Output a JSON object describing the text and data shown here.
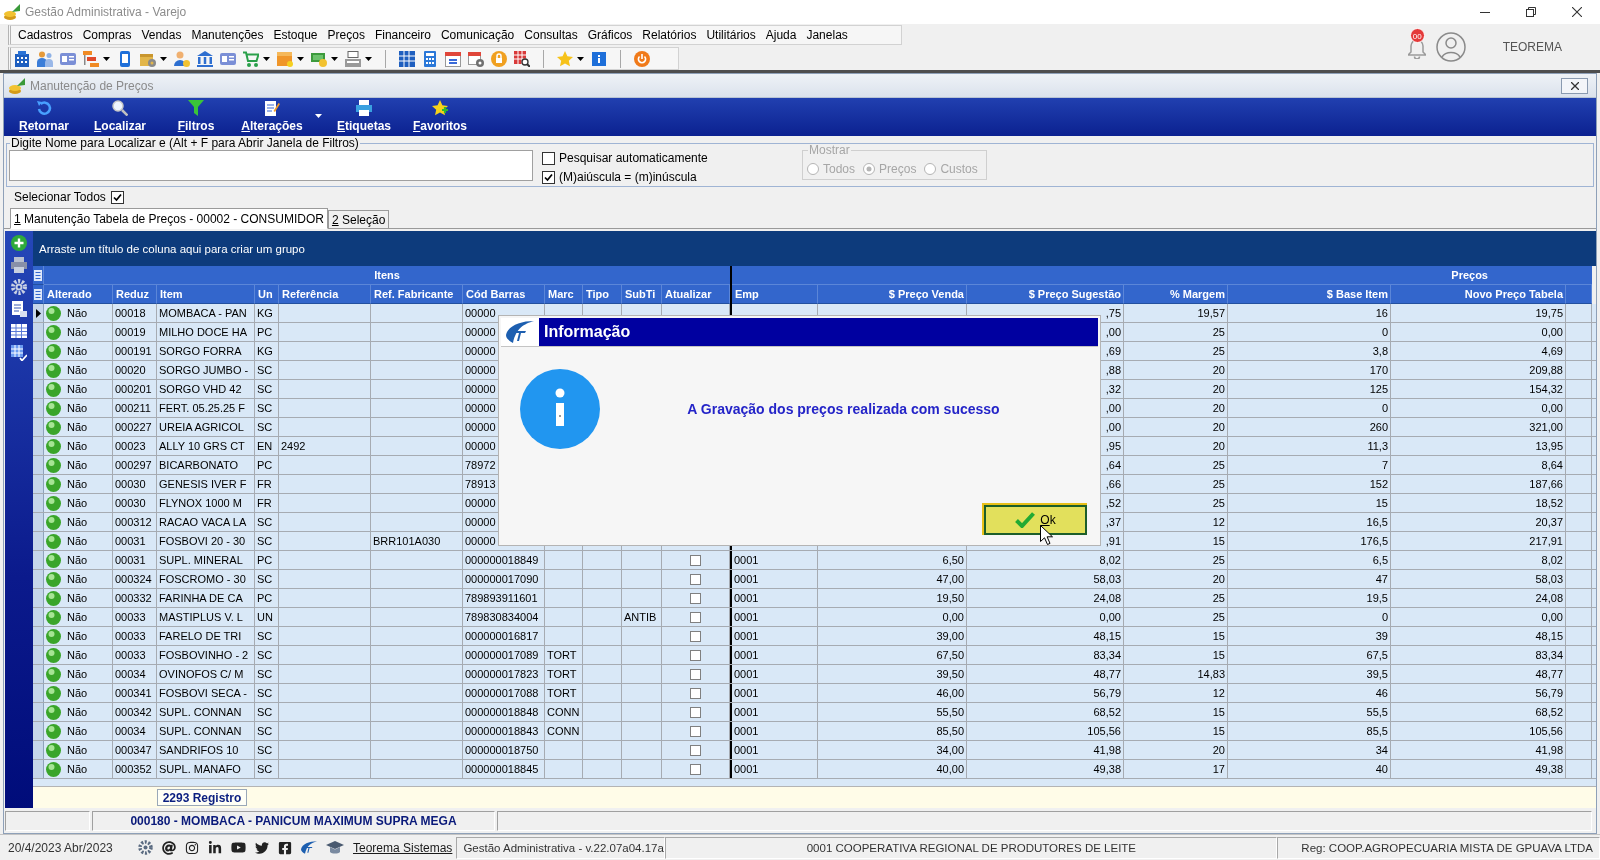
{
  "window": {
    "title": "Gestão Administrativa - Varejo"
  },
  "menu": [
    "Cadastros",
    "Compras",
    "Vendas",
    "Manutenções",
    "Estoque",
    "Preços",
    "Financeiro",
    "Comunicação",
    "Consultas",
    "Gráficos",
    "Relatórios",
    "Utilitários",
    "Ajuda",
    "Janelas"
  ],
  "notifications": {
    "badge": "00"
  },
  "user": {
    "name": "TEOREMA"
  },
  "child_window": {
    "title": "Manutenção de Preços"
  },
  "actions": [
    {
      "label": "Retornar",
      "dropdown": false
    },
    {
      "label": "Localizar",
      "dropdown": false
    },
    {
      "label": "Filtros",
      "dropdown": false
    },
    {
      "label": "Alterações",
      "dropdown": true
    },
    {
      "label": "Etiquetas",
      "dropdown": false
    },
    {
      "label": "Favoritos",
      "dropdown": false
    }
  ],
  "search": {
    "legend": "Digite Nome para Localizar e (Alt + F para Abrir Janela de Filtros)",
    "options": [
      {
        "label": "Pesquisar automaticamente",
        "checked": false
      },
      {
        "label": "(M)aiúscula = (m)inúscula",
        "checked": true
      }
    ]
  },
  "show": {
    "legend": "Mostrar",
    "disabled": true,
    "options": [
      {
        "label": "Todos",
        "selected": false
      },
      {
        "label": "Preços",
        "selected": true
      },
      {
        "label": "Custos",
        "selected": false
      }
    ]
  },
  "select_all": {
    "label": "Selecionar Todos",
    "checked": true
  },
  "tabs": [
    {
      "label": "1 Manutenção Tabela de Preços - 00002 - CONSUMIDOR",
      "selected": true
    },
    {
      "label": "2 Seleção",
      "selected": false
    }
  ],
  "grid": {
    "group_hint": "Arraste um título de coluna aqui para criar um grupo",
    "bands": [
      {
        "label": "Itens",
        "columns": [
          {
            "label": "Alterado",
            "kind": "status"
          },
          {
            "label": "Reduz",
            "kind": "text"
          },
          {
            "label": "Item",
            "kind": "text"
          },
          {
            "label": "Un",
            "kind": "text"
          },
          {
            "label": "Referência",
            "kind": "text"
          },
          {
            "label": "Ref. Fabricante",
            "kind": "text"
          },
          {
            "label": "Cód Barras",
            "kind": "text"
          },
          {
            "label": "Marc",
            "kind": "text"
          },
          {
            "label": "Tipo",
            "kind": "text"
          },
          {
            "label": "SubTi",
            "kind": "text"
          },
          {
            "label": "Atualizar",
            "kind": "check"
          }
        ]
      },
      {
        "label": "Preços",
        "columns": [
          {
            "label": "Emp",
            "kind": "text"
          },
          {
            "label": "$ Preço Venda",
            "kind": "number"
          },
          {
            "label": "$ Preço Sugestão",
            "kind": "number"
          },
          {
            "label": "% Margem",
            "kind": "number"
          },
          {
            "label": "$ Base Item",
            "kind": "number"
          },
          {
            "label": "Novo Preço Tabela",
            "kind": "number"
          }
        ]
      }
    ],
    "rows": [
      {
        "selected": true,
        "cells": [
          "Não",
          "00018",
          "MOMBACA - PAN",
          "KG",
          null,
          null,
          "00000",
          null,
          null,
          null,
          null,
          null,
          null,
          ",75",
          "19,57",
          "16",
          "19,75"
        ]
      },
      {
        "selected": false,
        "cells": [
          "Não",
          "00019",
          "MILHO DOCE HA",
          "PC",
          null,
          null,
          "00000",
          null,
          null,
          null,
          null,
          null,
          null,
          ",00",
          "25",
          "0",
          "0,00"
        ]
      },
      {
        "selected": false,
        "cells": [
          "Não",
          "000191",
          "SORGO FORRA",
          "KG",
          null,
          null,
          "00000",
          null,
          null,
          null,
          null,
          null,
          null,
          ",69",
          "25",
          "3,8",
          "4,69"
        ]
      },
      {
        "selected": false,
        "cells": [
          "Não",
          "00020",
          "SORGO JUMBO -",
          "SC",
          null,
          null,
          "00000",
          null,
          null,
          null,
          null,
          null,
          null,
          ",88",
          "20",
          "170",
          "209,88"
        ]
      },
      {
        "selected": false,
        "cells": [
          "Não",
          "000201",
          "SORGO VHD 42",
          "SC",
          null,
          null,
          "00000",
          null,
          null,
          null,
          null,
          null,
          null,
          ",32",
          "20",
          "125",
          "154,32"
        ]
      },
      {
        "selected": false,
        "cells": [
          "Não",
          "000211",
          "FERT. 05.25.25 F",
          "SC",
          null,
          null,
          "00000",
          null,
          null,
          null,
          null,
          null,
          null,
          ",00",
          "20",
          "0",
          "0,00"
        ]
      },
      {
        "selected": false,
        "cells": [
          "Não",
          "000227",
          "UREIA AGRICOL",
          "SC",
          null,
          null,
          "00000",
          null,
          null,
          null,
          null,
          null,
          null,
          ",00",
          "20",
          "260",
          "321,00"
        ]
      },
      {
        "selected": false,
        "cells": [
          "Não",
          "00023",
          "ALLY 10 GRS CT",
          "EN",
          "2492",
          null,
          "00000",
          null,
          null,
          null,
          null,
          null,
          null,
          ",95",
          "20",
          "11,3",
          "13,95"
        ]
      },
      {
        "selected": false,
        "cells": [
          "Não",
          "000297",
          "BICARBONATO",
          "PC",
          null,
          null,
          "78972",
          null,
          null,
          null,
          null,
          null,
          null,
          ",64",
          "25",
          "7",
          "8,64"
        ]
      },
      {
        "selected": false,
        "cells": [
          "Não",
          "00030",
          "GENESIS IVER F",
          "FR",
          null,
          null,
          "78913",
          null,
          null,
          null,
          null,
          null,
          null,
          ",66",
          "25",
          "152",
          "187,66"
        ]
      },
      {
        "selected": false,
        "cells": [
          "Não",
          "00030",
          "FLYNOX 1000 M",
          "FR",
          null,
          null,
          "00000",
          null,
          null,
          null,
          null,
          null,
          null,
          ",52",
          "25",
          "15",
          "18,52"
        ]
      },
      {
        "selected": false,
        "cells": [
          "Não",
          "000312",
          "RACAO VACA LA",
          "SC",
          null,
          null,
          "00000",
          null,
          null,
          null,
          null,
          null,
          null,
          ",37",
          "12",
          "16,5",
          "20,37"
        ]
      },
      {
        "selected": false,
        "cells": [
          "Não",
          "00031",
          "FOSBOVI 20 - 30",
          "SC",
          null,
          "BRR101A030",
          "00000",
          null,
          null,
          null,
          null,
          null,
          null,
          ",91",
          "15",
          "176,5",
          "217,91"
        ]
      },
      {
        "selected": false,
        "cells": [
          "Não",
          "00031",
          "SUPL. MINERAL",
          "PC",
          null,
          null,
          "000000018849",
          null,
          null,
          null,
          false,
          "0001",
          "6,50",
          "8,02",
          "25",
          "6,5",
          "8,02"
        ]
      },
      {
        "selected": false,
        "cells": [
          "Não",
          "000324",
          "FOSCROMO - 30",
          "SC",
          null,
          null,
          "000000017090",
          null,
          null,
          null,
          false,
          "0001",
          "47,00",
          "58,03",
          "20",
          "47",
          "58,03"
        ]
      },
      {
        "selected": false,
        "cells": [
          "Não",
          "000332",
          "FARINHA DE CA",
          "PC",
          null,
          null,
          "789893911601",
          null,
          null,
          null,
          false,
          "0001",
          "19,50",
          "24,08",
          "25",
          "19,5",
          "24,08"
        ]
      },
      {
        "selected": false,
        "cells": [
          "Não",
          "00033",
          "MASTIPLUS V. L",
          "UN",
          null,
          null,
          "789830834004",
          null,
          null,
          "ANTIB",
          false,
          "0001",
          "0,00",
          "0,00",
          "25",
          "0",
          "0,00"
        ]
      },
      {
        "selected": false,
        "cells": [
          "Não",
          "00033",
          "FARELO DE TRI",
          "SC",
          null,
          null,
          "000000016817",
          null,
          null,
          null,
          false,
          "0001",
          "39,00",
          "48,15",
          "15",
          "39",
          "48,15"
        ]
      },
      {
        "selected": false,
        "cells": [
          "Não",
          "00033",
          "FOSBOVINHO - 2",
          "SC",
          null,
          null,
          "000000017089",
          "TORT",
          null,
          null,
          false,
          "0001",
          "67,50",
          "83,34",
          "15",
          "67,5",
          "83,34"
        ]
      },
      {
        "selected": false,
        "cells": [
          "Não",
          "00034",
          "OVINOFOS C/ M",
          "SC",
          null,
          null,
          "000000017823",
          "TORT",
          null,
          null,
          false,
          "0001",
          "39,50",
          "48,77",
          "14,83",
          "39,5",
          "48,77"
        ]
      },
      {
        "selected": false,
        "cells": [
          "Não",
          "000341",
          "FOSBOVI SECA -",
          "SC",
          null,
          null,
          "000000017088",
          "TORT",
          null,
          null,
          false,
          "0001",
          "46,00",
          "56,79",
          "12",
          "46",
          "56,79"
        ]
      },
      {
        "selected": false,
        "cells": [
          "Não",
          "000342",
          "SUPL. CONNAN",
          "SC",
          null,
          null,
          "000000018848",
          "CONN",
          null,
          null,
          false,
          "0001",
          "55,50",
          "68,52",
          "15",
          "55,5",
          "68,52"
        ]
      },
      {
        "selected": false,
        "cells": [
          "Não",
          "00034",
          "SUPL. CONNAN",
          "SC",
          null,
          null,
          "000000018843",
          "CONN",
          null,
          null,
          false,
          "0001",
          "85,50",
          "105,56",
          "15",
          "85,5",
          "105,56"
        ]
      },
      {
        "selected": false,
        "cells": [
          "Não",
          "000347",
          "SANDRIFOS 10",
          "SC",
          null,
          null,
          "000000018750",
          null,
          null,
          null,
          false,
          "0001",
          "34,00",
          "41,98",
          "20",
          "34",
          "41,98"
        ]
      },
      {
        "selected": false,
        "cells": [
          "Não",
          "000352",
          "SUPL. MANAFO",
          "SC",
          null,
          null,
          "000000018845",
          null,
          null,
          null,
          false,
          "0001",
          "40,00",
          "49,38",
          "17",
          "40",
          "49,38"
        ]
      }
    ],
    "footer": {
      "count": "2293 Registro"
    }
  },
  "status_bar": {
    "selected_item": "000180 - MOMBACA - PANICUM MAXIMUM SUPRA MEGA"
  },
  "dialog": {
    "title": "Informação",
    "message": "A Gravação dos preços realizada com sucesso",
    "button": "Ok"
  },
  "taskbar": {
    "date": "20/4/2023 Abr/2023",
    "link": "Teorema Sistemas",
    "version": "Gestão Administrativa - v.22.07a04.17a",
    "company": "0001 COOPERATIVA REGIONAL DE PRODUTORES DE LEITE",
    "registration": "Reg: COOP.AGROPECUARIA MISTA DE GPUAVA LTDA"
  }
}
